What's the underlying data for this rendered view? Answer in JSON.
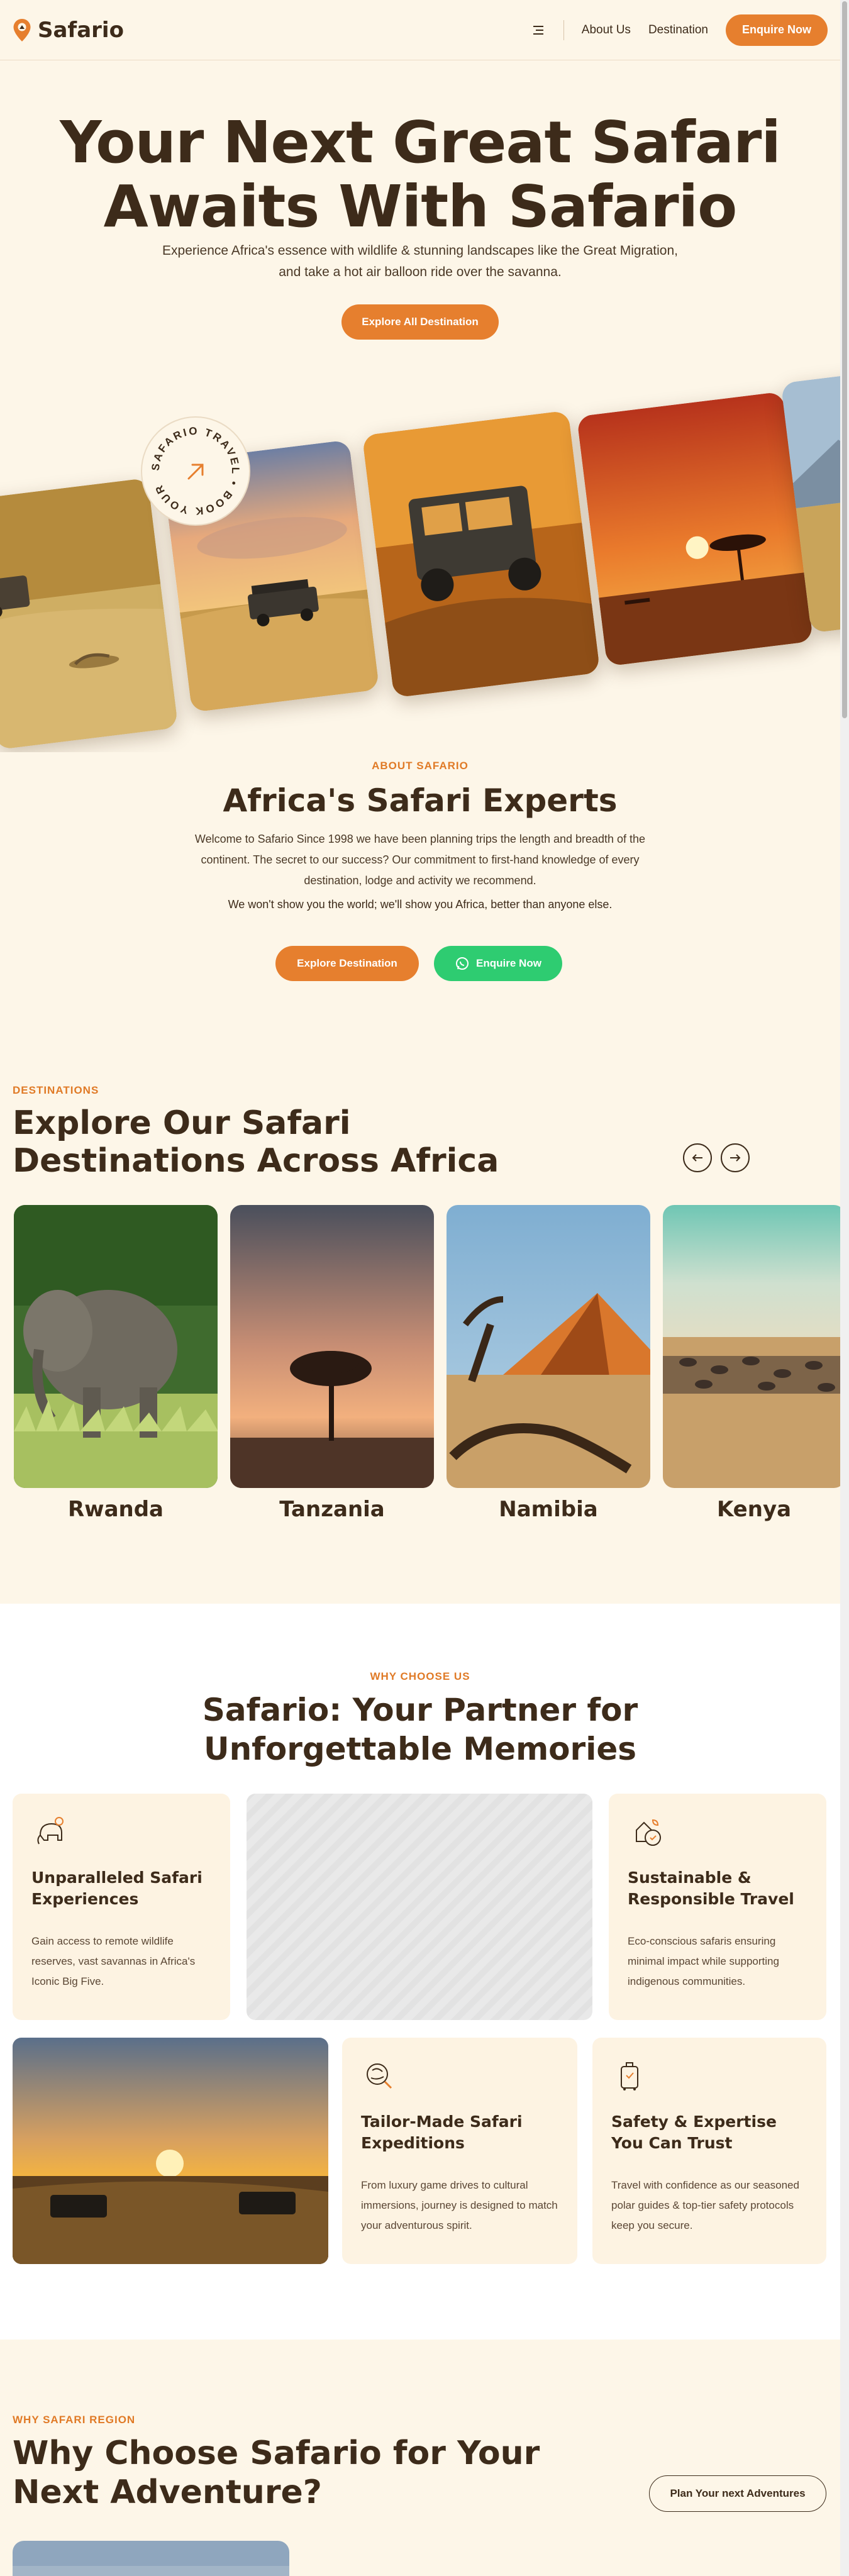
{
  "header": {
    "logo_text": "Safario",
    "nav": [
      "About Us",
      "Destination"
    ],
    "enquire_label": "Enquire Now"
  },
  "hero": {
    "title": "Your Next Great Safari Awaits With Safario",
    "subtitle": "Experience Africa's essence with wildlife & stunning landscapes like the Great Migration, and take a hot air balloon ride over the savanna.",
    "cta": "Explore All Destination",
    "badge_text": "SAFARIO TRAVEL • BOOK YOUR "
  },
  "about": {
    "eyebrow": "ABOUT SAFARIO",
    "title": "Africa's Safari  Experts",
    "paragraph": "Welcome to Safario Since 1998 we have been planning trips the length and breadth of the continent. The secret to our success? Our commitment to first-hand knowledge of every destination, lodge and activity we recommend.",
    "tagline": "We won't show you the world; we'll show you Africa, better than anyone else.",
    "btn_explore": "Explore Destination",
    "btn_enquire": "Enquire Now"
  },
  "destinations": {
    "eyebrow": "DESTINATIONS",
    "title_line1": "Explore Our Safari",
    "title_line2": "Destinations Across Africa",
    "items": [
      "Rwanda",
      "Tanzania",
      "Namibia",
      "Kenya"
    ]
  },
  "why": {
    "eyebrow": "WHY CHOOSE US",
    "title_line1": "Safario: Your Partner for",
    "title_line2": "Unforgettable Memories",
    "features": [
      {
        "title": "Unparalleled Safari Experiences",
        "text": "Gain access to remote wildlife reserves, vast savannas in Africa's Iconic Big Five.",
        "icon": "elephant-icon"
      },
      {
        "title": "Sustainable & Responsible Travel",
        "text": "Eco-conscious safaris ensuring minimal impact while supporting indigenous communities.",
        "icon": "eco-globe-icon"
      },
      {
        "title": "Tailor-Made Safari Expeditions",
        "text": "From luxury game drives to cultural immersions,  journey is designed to match your adventurous spirit.",
        "icon": "safari-map-icon"
      },
      {
        "title": "Safety & Expertise You Can Trust",
        "text": "Travel with confidence as our seasoned polar guides & top-tier safety protocols keep you secure.",
        "icon": "luggage-icon"
      }
    ]
  },
  "region": {
    "eyebrow": "WHY SAFARI REGION",
    "title_line1": "Why Choose Safario for Your",
    "title_line2": "Next Adventure?",
    "button": "Plan Your next Adventures"
  },
  "colors": {
    "accent": "#e67f2e",
    "background": "#fdf6e8",
    "text": "#3d2b1a",
    "whatsapp": "#2ecc71"
  }
}
